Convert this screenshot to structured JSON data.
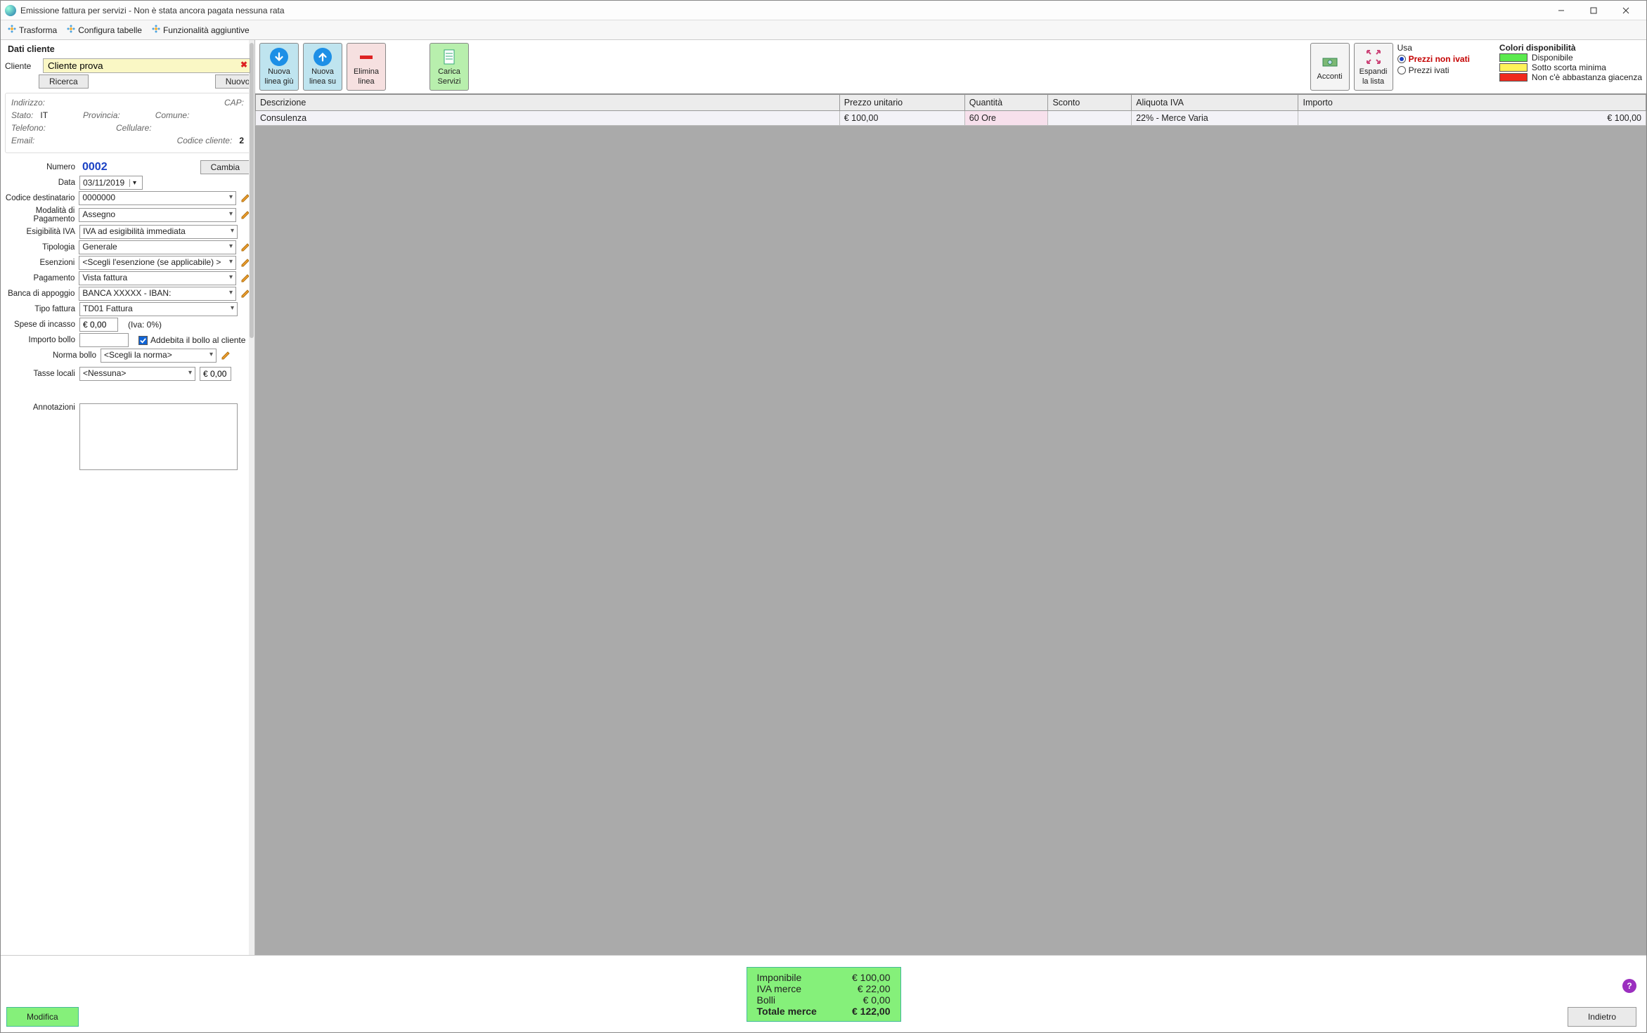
{
  "window": {
    "title": "Emissione fattura per servizi - Non è stata ancora pagata nessuna rata"
  },
  "menu": {
    "trasforma": "Trasforma",
    "configura": "Configura tabelle",
    "funzionalita": "Funzionalità aggiuntive"
  },
  "left": {
    "panel_title": "Dati cliente",
    "cliente_label": "Cliente",
    "cliente_value": "Cliente prova",
    "ricerca": "Ricerca",
    "nuovo": "Nuovo",
    "addr": {
      "indirizzo_l": "Indirizzo:",
      "cap_l": "CAP:",
      "stato_l": "Stato:",
      "stato_v": "IT",
      "provincia_l": "Provincia:",
      "comune_l": "Comune:",
      "telefono_l": "Telefono:",
      "cellulare_l": "Cellulare:",
      "email_l": "Email:",
      "codice_cliente_l": "Codice cliente:",
      "codice_cliente_v": "2"
    },
    "numero_l": "Numero",
    "numero_v": "0002",
    "cambia": "Cambia",
    "data_l": "Data",
    "data_v": "03/11/2019",
    "codice_dest_l": "Codice destinatario",
    "codice_dest_v": "0000000",
    "mod_pag_l": "Modalità di Pagamento",
    "mod_pag_v": "Assegno",
    "esig_l": "Esigibilità IVA",
    "esig_v": "IVA ad esigibilità immediata",
    "tipologia_l": "Tipologia",
    "tipologia_v": "Generale",
    "esenzioni_l": "Esenzioni",
    "esenzioni_v": "<Scegli l'esenzione (se applicabile) >",
    "pagamento_l": "Pagamento",
    "pagamento_v": "Vista fattura",
    "banca_l": "Banca di appoggio",
    "banca_v": "BANCA XXXXX - IBAN:",
    "tipof_l": "Tipo fattura",
    "tipof_v": "TD01 Fattura",
    "spese_l": "Spese di incasso",
    "spese_v": "€ 0,00",
    "spese_iva": "(Iva: 0%)",
    "impbollo_l": "Importo bollo",
    "impbollo_v": "",
    "addebita": "Addebita il bollo al cliente",
    "normabollo_l": "Norma bollo",
    "normabollo_v": "<Scegli la norma>",
    "tasse_l": "Tasse locali",
    "tasse_v": "<Nessuna>",
    "tasse_amt": "€ 0,00",
    "annot_l": "Annotazioni",
    "annot_v": ""
  },
  "toolbar": [
    {
      "l1": "Nuova",
      "l2": "linea giù"
    },
    {
      "l1": "Nuova",
      "l2": "linea su"
    },
    {
      "l1": "Elimina",
      "l2": "linea"
    },
    {
      "l1": "Carica",
      "l2": "Servizi"
    },
    {
      "l1": "Acconti",
      "l2": ""
    },
    {
      "l1": "Espandi",
      "l2": "la lista"
    }
  ],
  "usa": {
    "title": "Usa",
    "opt1": "Prezzi non ivati",
    "opt2": "Prezzi ivati"
  },
  "legend": {
    "title": "Colori disponibilità",
    "l1": "Disponibile",
    "l2": "Sotto scorta minima",
    "l3": "Non c'è abbastanza giacenza"
  },
  "grid": {
    "headers": {
      "desc": "Descrizione",
      "prezzo": "Prezzo unitario",
      "qty": "Quantità",
      "sconto": "Sconto",
      "iva": "Aliquota IVA",
      "importo": "Importo"
    },
    "rows": [
      {
        "desc": "Consulenza",
        "prezzo": "€ 100,00",
        "qty": "60 Ore",
        "sconto": "",
        "iva": "22% - Merce Varia",
        "importo": "€ 100,00"
      }
    ]
  },
  "totals": {
    "imponibile_l": "Imponibile",
    "imponibile_v": "€ 100,00",
    "iva_l": "IVA merce",
    "iva_v": "€ 22,00",
    "bolli_l": "Bolli",
    "bolli_v": "€ 0,00",
    "totale_l": "Totale merce",
    "totale_v": "€ 122,00"
  },
  "bottom": {
    "modifica": "Modifica",
    "indietro": "Indietro"
  }
}
